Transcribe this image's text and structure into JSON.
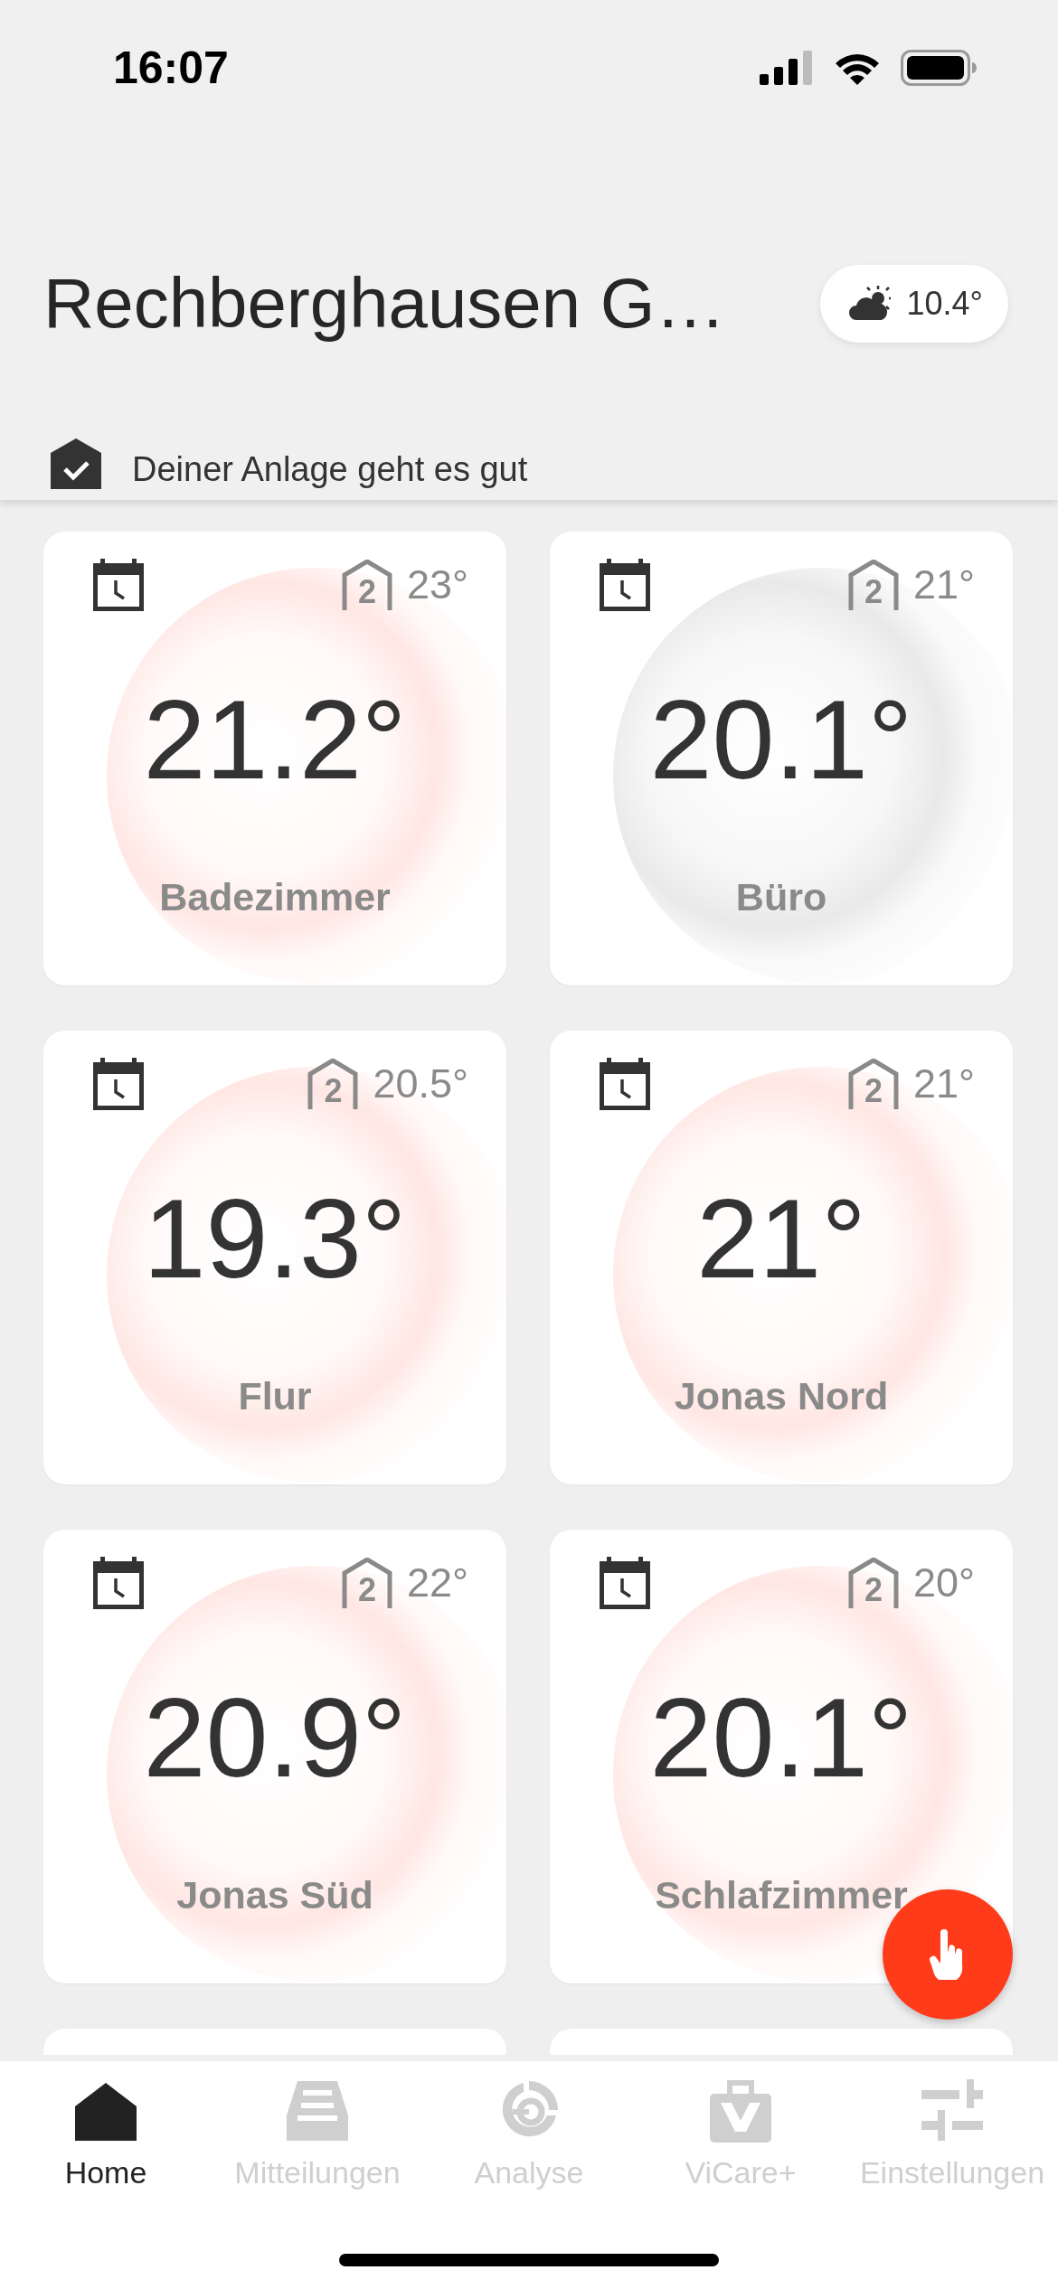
{
  "status_bar": {
    "time": "16:07"
  },
  "header": {
    "title": "Rechberghausen G…",
    "weather": {
      "temperature": "10.4°"
    },
    "health": {
      "text": "Deiner Anlage geht es gut"
    }
  },
  "rooms": [
    {
      "setpoint": "23°",
      "program": "2",
      "temperature": "21.2°",
      "name": "Badezimmer",
      "heating": true
    },
    {
      "setpoint": "21°",
      "program": "2",
      "temperature": "20.1°",
      "name": "Büro",
      "heating": false
    },
    {
      "setpoint": "20.5°",
      "program": "2",
      "temperature": "19.3°",
      "name": "Flur",
      "heating": true
    },
    {
      "setpoint": "21°",
      "program": "2",
      "temperature": "21°",
      "name": "Jonas Nord",
      "heating": true
    },
    {
      "setpoint": "22°",
      "program": "2",
      "temperature": "20.9°",
      "name": "Jonas Süd",
      "heating": true
    },
    {
      "setpoint": "20°",
      "program": "2",
      "temperature": "20.1°",
      "name": "Schlafzimmer",
      "heating": true
    }
  ],
  "tab_bar": [
    {
      "kind": "home",
      "label": "Home",
      "selected": true
    },
    {
      "kind": "messages",
      "label": "Mitteilungen",
      "selected": false
    },
    {
      "kind": "analysis",
      "label": "Analyse",
      "selected": false
    },
    {
      "kind": "shop",
      "label": "ViCare+",
      "selected": false
    },
    {
      "kind": "settings",
      "label": "Einstellungen",
      "selected": false
    }
  ]
}
